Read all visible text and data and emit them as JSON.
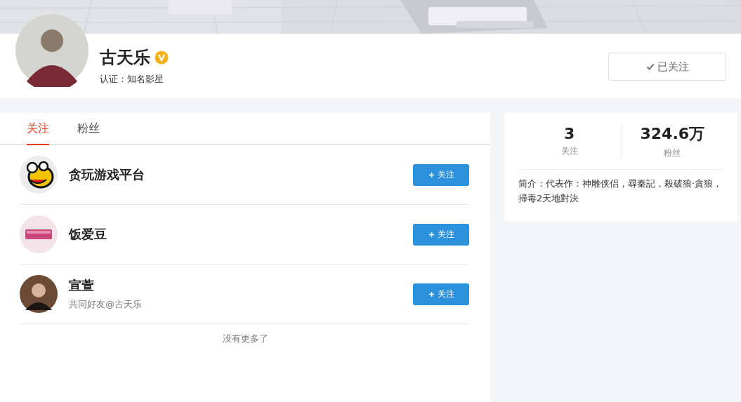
{
  "profile": {
    "name": "古天乐",
    "verified": true,
    "certification": "认证：知名影星",
    "follow_button": {
      "label": "已关注",
      "followed": true
    }
  },
  "tabs": [
    {
      "label": "关注",
      "selected": true
    },
    {
      "label": "粉丝",
      "selected": false
    }
  ],
  "following": [
    {
      "name": "贪玩游戏平台",
      "follow_button": {
        "label": "关注",
        "followed": false
      }
    },
    {
      "name": "饭爱豆",
      "follow_button": {
        "label": "关注",
        "followed": false
      }
    },
    {
      "name": "宣萱",
      "mutual": "共同好友@古天乐",
      "follow_button": {
        "label": "关注",
        "followed": false
      }
    }
  ],
  "end_note": "没有更多了",
  "stats": [
    {
      "value": "3",
      "label": "关注"
    },
    {
      "value": "324.6万",
      "label": "粉丝"
    }
  ],
  "bio": "简介：代表作：神雕侠侣，尋秦記，殺破狼·貪狼，掃毒2天地對決"
}
